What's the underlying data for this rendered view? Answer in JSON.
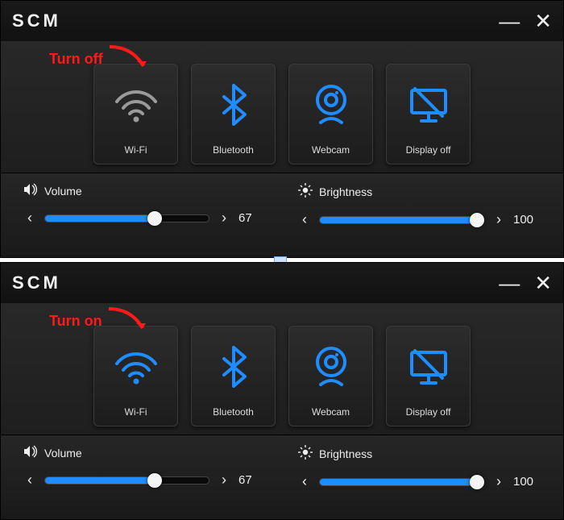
{
  "app": {
    "logo": "SCM"
  },
  "annotations": [
    {
      "text": "Turn off"
    },
    {
      "text": "Turn on"
    }
  ],
  "tiles": [
    {
      "id": "wifi",
      "label": "Wi-Fi"
    },
    {
      "id": "bluetooth",
      "label": "Bluetooth"
    },
    {
      "id": "webcam",
      "label": "Webcam"
    },
    {
      "id": "displayoff",
      "label": "Display off"
    }
  ],
  "sliders": {
    "volume": {
      "label": "Volume",
      "value": 67
    },
    "brightness": {
      "label": "Brightness",
      "value": 100
    }
  },
  "panels": [
    {
      "wifi_active": false
    },
    {
      "wifi_active": true
    }
  ],
  "colors": {
    "accent": "#1f8dff",
    "inactive": "#9a9a9a",
    "annotation": "#ff1a1a"
  }
}
